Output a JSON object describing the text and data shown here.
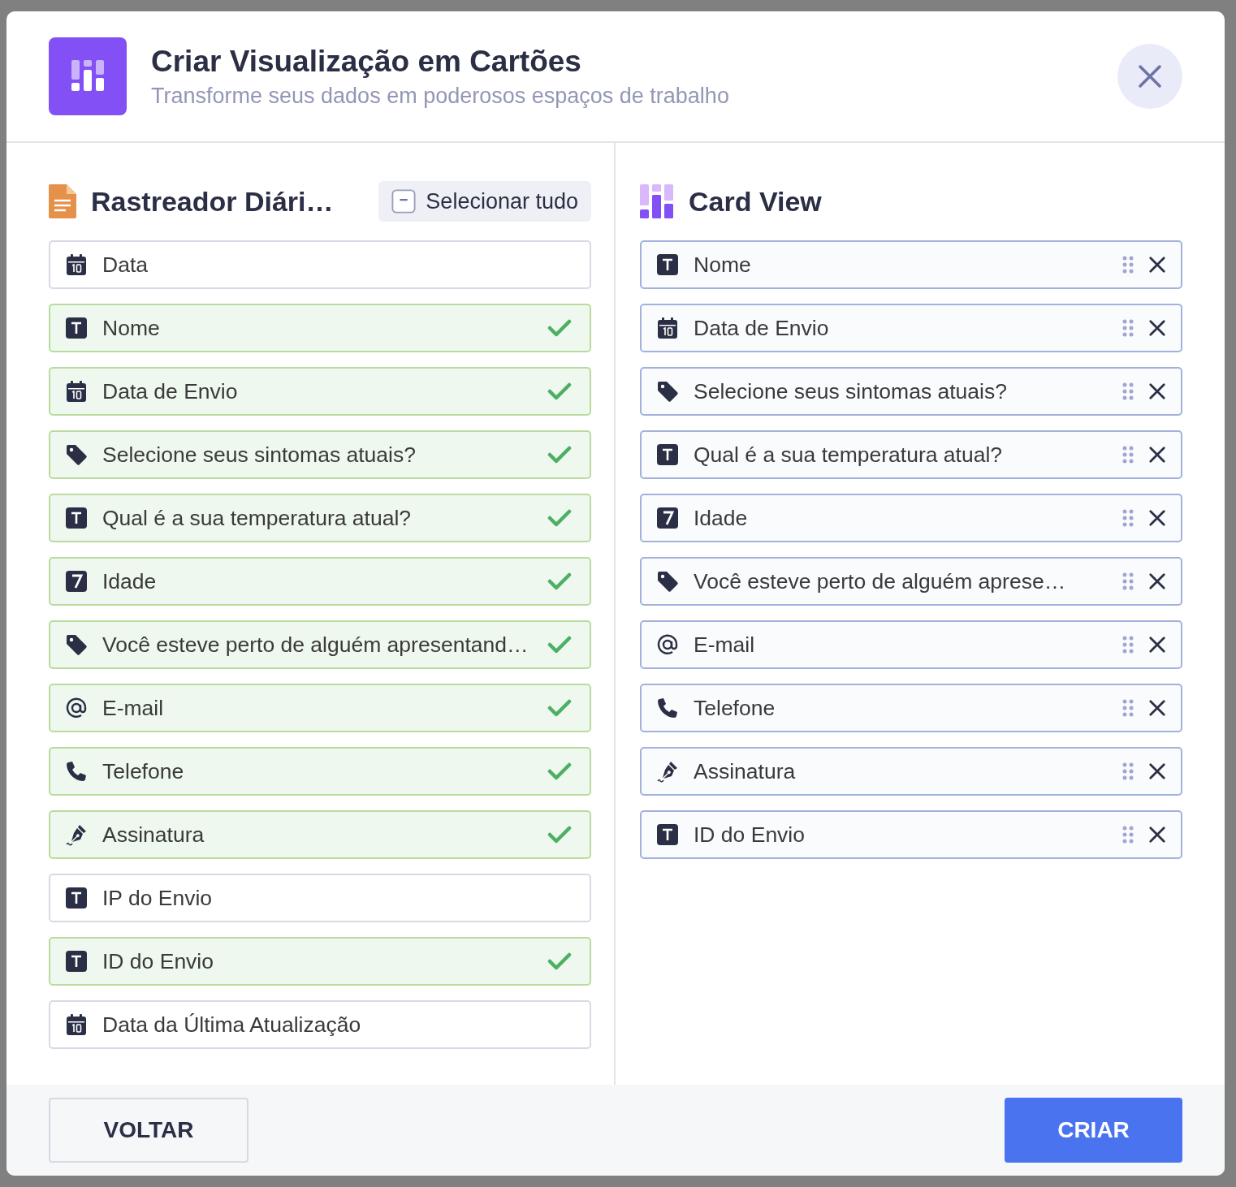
{
  "dialog": {
    "title": "Criar Visualização em Cartões",
    "subtitle": "Transforme seus dados em poderosos espaços de trabalho"
  },
  "source": {
    "title": "Rastreador Diári…",
    "select_all": "Selecionar tudo",
    "fields": [
      {
        "label": "Data",
        "kind": "date",
        "selected": false
      },
      {
        "label": "Nome",
        "kind": "text",
        "selected": true
      },
      {
        "label": "Data de Envio",
        "kind": "date",
        "selected": true
      },
      {
        "label": "Selecione seus sintomas atuais?",
        "kind": "tag",
        "selected": true
      },
      {
        "label": "Qual é a sua temperatura atual?",
        "kind": "text",
        "selected": true
      },
      {
        "label": "Idade",
        "kind": "number",
        "selected": true
      },
      {
        "label": "Você esteve perto de alguém apresentand…",
        "kind": "tag",
        "selected": true
      },
      {
        "label": "E-mail",
        "kind": "email",
        "selected": true
      },
      {
        "label": "Telefone",
        "kind": "phone",
        "selected": true
      },
      {
        "label": "Assinatura",
        "kind": "signature",
        "selected": true
      },
      {
        "label": "IP do Envio",
        "kind": "text",
        "selected": false
      },
      {
        "label": "ID do Envio",
        "kind": "text",
        "selected": true
      },
      {
        "label": "Data da Última Atualização",
        "kind": "date",
        "selected": false
      }
    ]
  },
  "target": {
    "title": "Card View",
    "fields": [
      {
        "label": "Nome",
        "kind": "text"
      },
      {
        "label": "Data de Envio",
        "kind": "date"
      },
      {
        "label": "Selecione seus sintomas atuais?",
        "kind": "tag"
      },
      {
        "label": "Qual é a sua temperatura atual?",
        "kind": "text"
      },
      {
        "label": "Idade",
        "kind": "number"
      },
      {
        "label": "Você esteve perto de alguém aprese…",
        "kind": "tag"
      },
      {
        "label": "E-mail",
        "kind": "email"
      },
      {
        "label": "Telefone",
        "kind": "phone"
      },
      {
        "label": "Assinatura",
        "kind": "signature"
      },
      {
        "label": "ID do Envio",
        "kind": "text"
      }
    ]
  },
  "footer": {
    "back": "VOLTAR",
    "create": "CRIAR"
  }
}
